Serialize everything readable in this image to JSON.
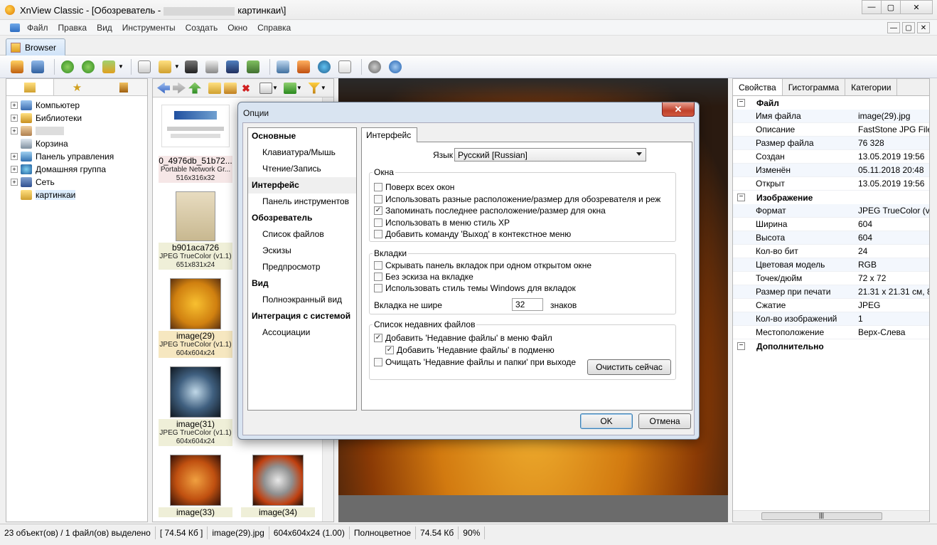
{
  "window": {
    "title_prefix": "XnView Classic - [Обозреватель -",
    "title_suffix": "картинкаи\\]",
    "min": "—",
    "max": "▢",
    "close": "✕"
  },
  "menu": [
    "Файл",
    "Правка",
    "Вид",
    "Инструменты",
    "Создать",
    "Окно",
    "Справка"
  ],
  "tab": {
    "label": "Browser"
  },
  "tree": [
    {
      "label": "Компьютер",
      "exp": "+"
    },
    {
      "label": "Библиотеки",
      "exp": "+"
    },
    {
      "label": "",
      "exp": "+"
    },
    {
      "label": "Корзина",
      "exp": ""
    },
    {
      "label": "Панель управления",
      "exp": "+"
    },
    {
      "label": "Домашняя группа",
      "exp": "+"
    },
    {
      "label": "Сеть",
      "exp": "+"
    },
    {
      "label": "картинкаи",
      "exp": ""
    }
  ],
  "thumbs": [
    {
      "name": "0_4976db_51b72...",
      "meta1": "Portable Network Gr...",
      "meta2": "516x316x32"
    },
    {
      "name": "b901aca726",
      "meta1": "JPEG TrueColor (v1.1)",
      "meta2": "651x831x24"
    },
    {
      "name": "image(29)",
      "meta1": "JPEG TrueColor (v1.1)",
      "meta2": "604x604x24"
    },
    {
      "name": "image(31)",
      "meta1": "JPEG TrueColor (v1.1)",
      "meta2": "604x604x24"
    },
    {
      "name": "image(33)",
      "meta1": "",
      "meta2": ""
    },
    {
      "name": "image(34)",
      "meta1": "",
      "meta2": ""
    },
    {
      "name": "",
      "meta1": "",
      "meta2": "604x604x24"
    }
  ],
  "props": {
    "tabs": [
      "Свойства",
      "Гистограмма",
      "Категории"
    ],
    "groups": {
      "file": "Файл",
      "image": "Изображение",
      "extra": "Дополнительно"
    },
    "file": [
      {
        "k": "Имя файла",
        "v": "image(29).jpg"
      },
      {
        "k": "Описание",
        "v": "FastStone JPG File"
      },
      {
        "k": "Размер файла",
        "v": "76 328"
      },
      {
        "k": "Создан",
        "v": "13.05.2019 19:56"
      },
      {
        "k": "Изменён",
        "v": "05.11.2018 20:48"
      },
      {
        "k": "Открыт",
        "v": "13.05.2019 19:56"
      }
    ],
    "image": [
      {
        "k": "Формат",
        "v": "JPEG TrueColor (v1."
      },
      {
        "k": "Ширина",
        "v": "604"
      },
      {
        "k": "Высота",
        "v": "604"
      },
      {
        "k": "Кол-во бит",
        "v": "24"
      },
      {
        "k": "Цветовая модель",
        "v": "RGB"
      },
      {
        "k": "Точек/дюйм",
        "v": "72 x 72"
      },
      {
        "k": "Размер при печати",
        "v": "21.31 x 21.31 см, 8.3"
      },
      {
        "k": "Сжатие",
        "v": "JPEG"
      },
      {
        "k": "Кол-во изображений",
        "v": "1"
      },
      {
        "k": "Местоположение",
        "v": "Верх-Слева"
      }
    ],
    "scroll_grip": "|||"
  },
  "status": [
    "23 объект(ов) / 1 файл(ов) выделено",
    "[ 74.54 Кб ]",
    "image(29).jpg",
    "604x604x24 (1.00)",
    "Полноцветное",
    "74.54 Кб",
    "90%"
  ],
  "dialog": {
    "title": "Опции",
    "close": "✕",
    "list": [
      {
        "label": "Основные",
        "head": true
      },
      {
        "label": "Клавиатура/Мышь"
      },
      {
        "label": "Чтение/Запись"
      },
      {
        "label": "Интерфейс",
        "head": true,
        "sel": true
      },
      {
        "label": "Панель инструментов"
      },
      {
        "label": "Обозреватель",
        "head": true
      },
      {
        "label": "Список файлов"
      },
      {
        "label": "Эскизы"
      },
      {
        "label": "Предпросмотр"
      },
      {
        "label": "Вид",
        "head": true
      },
      {
        "label": "Полноэкранный вид"
      },
      {
        "label": "Интеграция с системой",
        "head": true
      },
      {
        "label": "Ассоциации"
      }
    ],
    "tab": "Интерфейс",
    "lang_label": "Язык",
    "lang_value": "Русский [Russian]",
    "group_windows": "Окна",
    "windows": [
      {
        "label": "Поверх всех окон",
        "checked": false
      },
      {
        "label": "Использовать разные расположение/размер для обозревателя и реж",
        "checked": false
      },
      {
        "label": "Запоминать последнее расположение/размер для окна",
        "checked": true
      },
      {
        "label": "Использовать в меню стиль XP",
        "checked": false
      },
      {
        "label": "Добавить команду 'Выход' в контекстное меню",
        "checked": false
      }
    ],
    "group_tabs": "Вкладки",
    "tabs": [
      {
        "label": "Скрывать панель вкладок при одном открытом окне",
        "checked": false
      },
      {
        "label": "Без эскиза на вкладке",
        "checked": false
      },
      {
        "label": "Использовать стиль темы Windows для вкладок",
        "checked": false
      }
    ],
    "tab_width_label": "Вкладка не шире",
    "tab_width_value": "32",
    "tab_width_unit": "знаков",
    "group_recent": "Список недавних файлов",
    "recent": [
      {
        "label": "Добавить 'Недавние файлы' в меню Файл",
        "checked": true
      },
      {
        "label": "Добавить 'Недавние файлы' в подменю",
        "checked": true
      },
      {
        "label": "Очищать 'Недавние файлы и папки' при выходе",
        "checked": false
      }
    ],
    "clear_button": "Очистить сейчас",
    "ok": "OK",
    "cancel": "Отмена"
  }
}
